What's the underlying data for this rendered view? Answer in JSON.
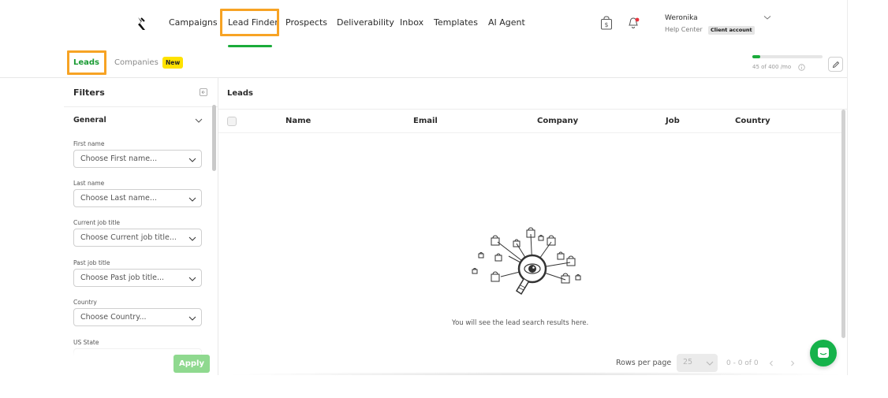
{
  "nav": {
    "logo_icon": "logo-bird-icon",
    "items": [
      {
        "label": "Campaigns"
      },
      {
        "label": "Lead Finder"
      },
      {
        "label": "Prospects"
      },
      {
        "label": "Deliverability"
      },
      {
        "label": "Inbox"
      },
      {
        "label": "Templates"
      },
      {
        "label": "AI Agent"
      }
    ],
    "active_index": 1,
    "store_icon": "dollar-bag-icon",
    "notification_icon": "bell-icon",
    "user": {
      "name": "Weronika",
      "help_label": "Help Center",
      "account_badge": "Client account"
    }
  },
  "tabs": {
    "leads_label": "Leads",
    "companies_label": "Companies",
    "new_badge": "New"
  },
  "usage": {
    "text": "45 of 400 /mo",
    "used": 45,
    "limit": 400
  },
  "filters": {
    "title": "Filters",
    "section_title": "General",
    "fields": [
      {
        "label": "First name",
        "placeholder": "Choose First name..."
      },
      {
        "label": "Last name",
        "placeholder": "Choose Last name..."
      },
      {
        "label": "Current job title",
        "placeholder": "Choose Current job title..."
      },
      {
        "label": "Past job title",
        "placeholder": "Choose Past job title..."
      },
      {
        "label": "Country",
        "placeholder": "Choose Country..."
      },
      {
        "label": "US State",
        "placeholder": ""
      }
    ],
    "apply_label": "Apply"
  },
  "leads": {
    "title": "Leads",
    "columns": [
      "Name",
      "Email",
      "Company",
      "Job",
      "Country"
    ],
    "rows": [],
    "empty_message": "You will see the lead search results here.",
    "pagination": {
      "rows_per_page_label": "Rows per page",
      "rows_per_page_value": "25",
      "range_text": "0 - 0 of 0"
    }
  },
  "colors": {
    "accent_green": "#1aab3a",
    "highlight_orange": "#f7a324",
    "new_badge_yellow": "#ffe200",
    "chat_green": "#16b24b"
  }
}
